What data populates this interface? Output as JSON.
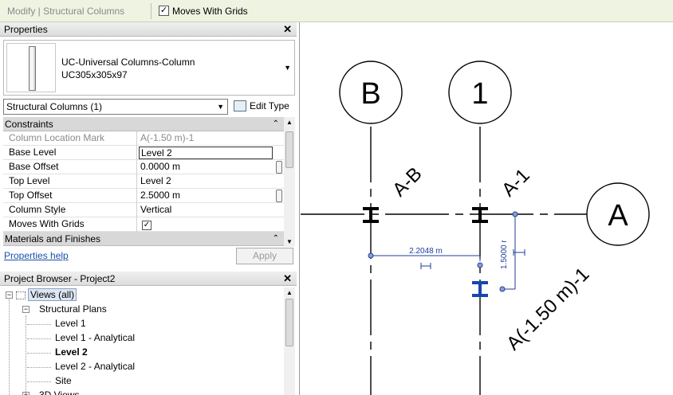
{
  "topbar": {
    "context_label": "Modify | Structural Columns",
    "moves_with_grids_label": "Moves With Grids",
    "moves_with_grids_checked": "✓"
  },
  "properties": {
    "title": "Properties",
    "close": "✕",
    "family": "UC-Universal Columns-Column",
    "type": "UC305x305x97",
    "selector": "Structural Columns (1)",
    "edit_type": "Edit Type",
    "sections": {
      "constraints": "Constraints",
      "materials": "Materials and Finishes",
      "collapse_glyph": "⌃"
    },
    "rows": [
      {
        "name": "Column Location Mark",
        "value": "A(-1.50 m)-1"
      },
      {
        "name": "Base Level",
        "value": "Level 2"
      },
      {
        "name": "Base Offset",
        "value": "0.0000 m"
      },
      {
        "name": "Top Level",
        "value": "Level 2"
      },
      {
        "name": "Top Offset",
        "value": "2.5000 m"
      },
      {
        "name": "Column Style",
        "value": "Vertical"
      },
      {
        "name": "Moves With Grids",
        "value": "✓"
      }
    ],
    "help_link": "Properties help",
    "apply_button": "Apply"
  },
  "project_browser": {
    "title": "Project Browser - Project2",
    "close": "✕",
    "tree": {
      "views_all": "Views (all)",
      "structural_plans": "Structural Plans",
      "level1": "Level 1",
      "level1_analytical": "Level 1 - Analytical",
      "level2": "Level 2",
      "level2_analytical": "Level 2 - Analytical",
      "site": "Site",
      "views_3d": "3D Views"
    }
  },
  "drawing": {
    "grid_bubbles": [
      "B",
      "1",
      "A"
    ],
    "labels": {
      "ab": "A-B",
      "a1": "A-1",
      "mark": "A(-1.50 m)-1"
    },
    "dim_horizontal": "2.2048 m",
    "dim_vertical": "1.5000 r",
    "colors": {
      "dim_blue": "#1f3f9a",
      "selected_column": "#1446b4"
    }
  }
}
